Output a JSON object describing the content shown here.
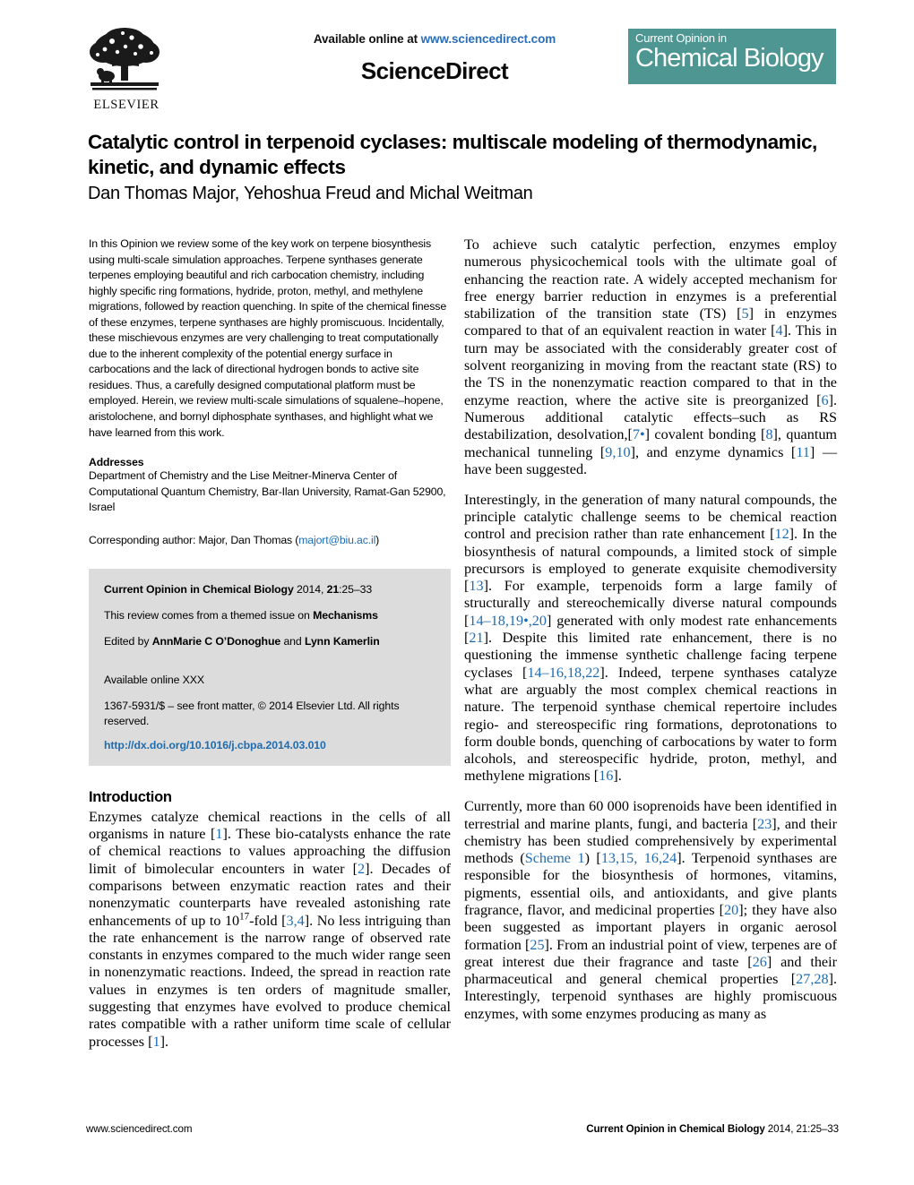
{
  "masthead": {
    "available_prefix": "Available online at ",
    "available_url": "www.sciencedirect.com",
    "sciencedirect": "ScienceDirect",
    "elsevier_wordmark": "ELSEVIER",
    "journal_badge_small": "Current Opinion in",
    "journal_badge_big": "Chemical Biology"
  },
  "article": {
    "title": "Catalytic control in terpenoid cyclases: multiscale modeling of thermodynamic, kinetic, and dynamic effects",
    "authors": "Dan Thomas Major, Yehoshua Freud and Michal Weitman"
  },
  "abstract": {
    "text": "In this Opinion we review some of the key work on terpene biosynthesis using multi-scale simulation approaches. Terpene synthases generate terpenes employing beautiful and rich carbocation chemistry, including highly specific ring formations, hydride, proton, methyl, and methylene migrations, followed by reaction quenching. In spite of the chemical finesse of these enzymes, terpene synthases are highly promiscuous. Incidentally, these mischievous enzymes are very challenging to treat computationally due to the inherent complexity of the potential energy surface in carbocations and the lack of directional hydrogen bonds to active site residues. Thus, a carefully designed computational platform must be employed. Herein, we review multi-scale simulations of squalene–hopene, aristolochene, and bornyl diphosphate synthases, and highlight what we have learned from this work."
  },
  "addresses": {
    "heading": "Addresses",
    "text": "Department of Chemistry and the Lise Meitner-Minerva Center of Computational Quantum Chemistry, Bar-Ilan University, Ramat-Gan 52900, Israel",
    "corresponding_prefix": "Corresponding author: Major, Dan Thomas (",
    "corresponding_email": "majort@biu.ac.il",
    "corresponding_suffix": ")"
  },
  "infobox": {
    "citation_journal": "Current Opinion in Chemical Biology",
    "citation_rest_pre": " 2014, ",
    "citation_volume": "21",
    "citation_pages": ":25–33",
    "themed_pre": "This review comes from a themed issue on ",
    "themed_topic": "Mechanisms",
    "edited_pre": "Edited by ",
    "editor_one": "AnnMarie C O’Donoghue",
    "edited_mid": " and ",
    "editor_two": "Lynn Kamerlin",
    "available_online": "Available online XXX",
    "frontmatter": "1367-5931/$ – see front matter, © 2014 Elsevier Ltd. All rights reserved.",
    "doi": "http://dx.doi.org/10.1016/j.cbpa.2014.03.010"
  },
  "introduction": {
    "heading": "Introduction",
    "para1_a": "Enzymes catalyze chemical reactions in the cells of all organisms in nature [",
    "para1_r1": "1",
    "para1_b": "]. These bio-catalysts enhance the rate of chemical reactions to values approaching the diffusion limit of bimolecular encounters in water [",
    "para1_r2": "2",
    "para1_c": "]. Decades of comparisons between enzymatic reaction rates and their nonenzymatic counterparts have revealed astonishing rate enhancements of up to 10",
    "para1_sup": "17",
    "para1_d": "-fold [",
    "para1_r3": "3,4",
    "para1_e": "]. No less intriguing than the rate enhancement is the narrow range of observed rate constants in enzymes compared to the much wider range seen in nonenzymatic reactions. Indeed, the spread in reaction rate values in enzymes is ten orders of magnitude smaller, suggesting that enzymes have evolved to produce chemical rates compatible with a rather uniform time scale of cellular processes [",
    "para1_r4": "1",
    "para1_f": "]."
  },
  "right_column": {
    "para1_a": "To achieve such catalytic perfection, enzymes employ numerous physicochemical tools with the ultimate goal of enhancing the reaction rate. A widely accepted mechanism for free energy barrier reduction in enzymes is a preferential stabilization of the transition state (TS) [",
    "para1_r1": "5",
    "para1_b": "] in enzymes compared to that of an equivalent reaction in water [",
    "para1_r2": "4",
    "para1_c": "]. This in turn may be associated with the considerably greater cost of solvent reorganizing in moving from the reactant state (RS) to the TS in the nonenzymatic reaction compared to that in the enzyme reaction, where the active site is preorganized [",
    "para1_r3": "6",
    "para1_d": "]. Numerous additional catalytic effects–such as RS destabilization, desolvation,[",
    "para1_r4": "7•",
    "para1_e": "] covalent bonding [",
    "para1_r5": "8",
    "para1_f": "], quantum mechanical tunneling [",
    "para1_r6": "9,10",
    "para1_g": "], and enzyme dynamics [",
    "para1_r7": "11",
    "para1_h": "] — have been suggested.",
    "para2_a": "Interestingly, in the generation of many natural compounds, the principle catalytic challenge seems to be chemical reaction control and precision rather than rate enhancement [",
    "para2_r1": "12",
    "para2_b": "]. In the biosynthesis of natural compounds, a limited stock of simple precursors is employed to generate exquisite chemodiversity [",
    "para2_r2": "13",
    "para2_c": "]. For example, terpenoids form a large family of structurally and stereochemically diverse natural compounds [",
    "para2_r3": "14–18,19•,20",
    "para2_d": "] generated with only modest rate enhancements [",
    "para2_r4": "21",
    "para2_e": "]. Despite this limited rate enhancement, there is no questioning the immense synthetic challenge facing terpene cyclases [",
    "para2_r5": "14–16,18,22",
    "para2_f": "]. Indeed, terpene synthases catalyze what are arguably the most complex chemical reactions in nature. The terpenoid synthase chemical repertoire includes regio- and stereospecific ring formations, deprotonations to form double bonds, quenching of carbocations by water to form alcohols, and stereospecific hydride, proton, methyl, and methylene migrations [",
    "para2_r6": "16",
    "para2_g": "].",
    "para3_a": "Currently, more than 60 000 isoprenoids have been identified in terrestrial and marine plants, fungi, and bacteria [",
    "para3_r1": "23",
    "para3_b": "], and their chemistry has been studied comprehensively by experimental methods (",
    "para3_scheme": "Scheme 1",
    "para3_c": ") [",
    "para3_r2": "13,15, 16,24",
    "para3_d": "]. Terpenoid synthases are responsible for the biosynthesis of hormones, vitamins, pigments, essential oils, and antioxidants, and give plants fragrance, flavor, and medicinal properties [",
    "para3_r3": "20",
    "para3_e": "]; they have also been suggested as important players in organic aerosol formation [",
    "para3_r4": "25",
    "para3_f": "]. From an industrial point of view, terpenes are of great interest due their fragrance and taste [",
    "para3_r5": "26",
    "para3_g": "] and their pharmaceutical and general chemical properties [",
    "para3_r6": "27,28",
    "para3_h": "]. Interestingly, terpenoid synthases are highly promiscuous enzymes, with some enzymes producing as many as"
  },
  "footer": {
    "left": "www.sciencedirect.com",
    "right_journal": "Current Opinion in Chemical Biology",
    "right_rest": " 2014, 21:25–33"
  },
  "colors": {
    "link_blue": "#1f6cb0",
    "badge_teal": "#4e9692",
    "infobox_gray": "#dcdcdc"
  }
}
